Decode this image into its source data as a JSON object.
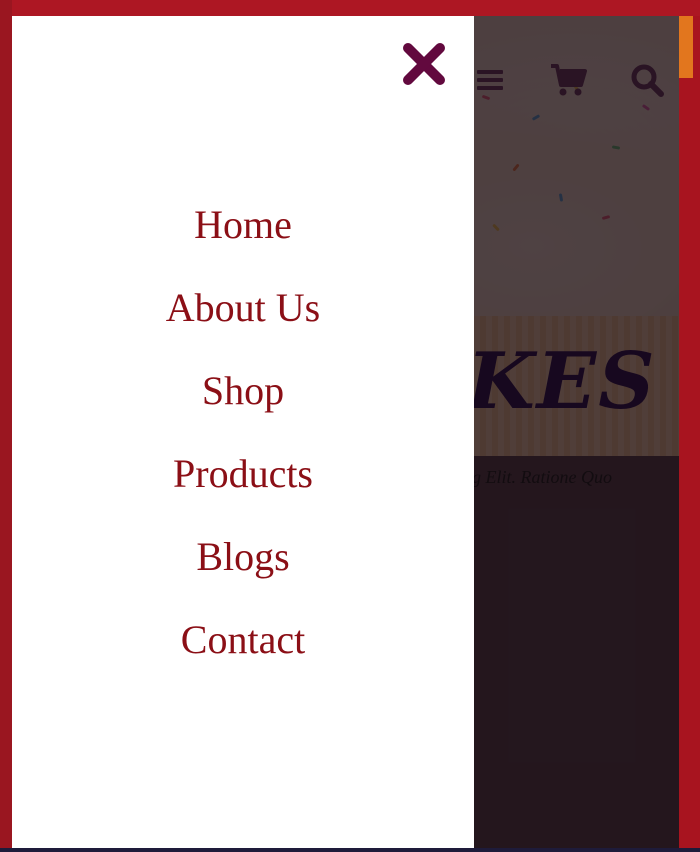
{
  "colors": {
    "accent_red": "#ad1723",
    "nav_text": "#8b0f16",
    "close_icon": "#62093e",
    "header_icon": "#2a1424",
    "orange_tab": "#e2761e"
  },
  "drawer": {
    "close_icon": "close-icon",
    "nav": [
      {
        "label": "Home"
      },
      {
        "label": "About Us"
      },
      {
        "label": "Shop"
      },
      {
        "label": "Products"
      },
      {
        "label": "Blogs"
      },
      {
        "label": "Contact"
      }
    ]
  },
  "header": {
    "icons": [
      "menu-icon",
      "cart-icon",
      "search-icon"
    ]
  },
  "hero": {
    "title_partial": "KES",
    "subtitle_partial": "ig Elit. Ratione Quo"
  }
}
